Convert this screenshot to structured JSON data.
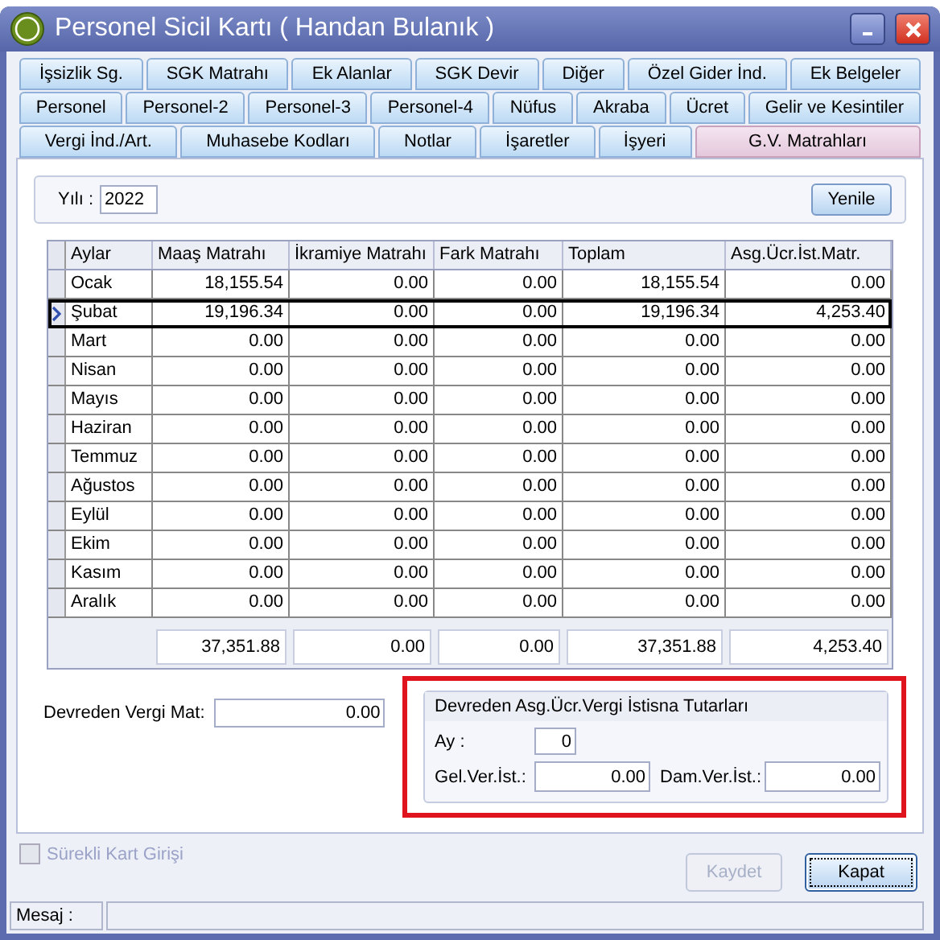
{
  "window": {
    "title": "Personel Sicil Kartı ( Handan Bulanık )"
  },
  "tab_rows": [
    [
      {
        "label": "İşsizlik Sg.",
        "selected": false
      },
      {
        "label": "SGK Matrahı",
        "selected": false
      },
      {
        "label": "Ek Alanlar",
        "selected": false
      },
      {
        "label": "SGK Devir",
        "selected": false
      },
      {
        "label": "Diğer",
        "selected": false
      },
      {
        "label": "Özel Gider İnd.",
        "selected": false
      },
      {
        "label": "Ek Belgeler",
        "selected": false
      }
    ],
    [
      {
        "label": "Personel",
        "selected": false
      },
      {
        "label": "Personel-2",
        "selected": false
      },
      {
        "label": "Personel-3",
        "selected": false
      },
      {
        "label": "Personel-4",
        "selected": false
      },
      {
        "label": "Nüfus",
        "selected": false
      },
      {
        "label": "Akraba",
        "selected": false
      },
      {
        "label": "Ücret",
        "selected": false
      },
      {
        "label": "Gelir ve Kesintiler",
        "selected": false
      }
    ],
    [
      {
        "label": "Vergi İnd./Art.",
        "selected": false
      },
      {
        "label": "Muhasebe Kodları",
        "selected": false
      },
      {
        "label": "Notlar",
        "selected": false
      },
      {
        "label": "İşaretler",
        "selected": false
      },
      {
        "label": "İşyeri",
        "selected": false
      },
      {
        "label": "G.V. Matrahları",
        "selected": true
      }
    ]
  ],
  "year": {
    "label": "Yılı :",
    "value": "2022"
  },
  "refresh_button": {
    "label": "Yenile"
  },
  "table": {
    "columns": [
      "Aylar",
      "Maaş Matrahı",
      "İkramiye Matrahı",
      "Fark Matrahı",
      "Toplam",
      "Asg.Ücr.İst.Matr."
    ],
    "rows": [
      {
        "cells": [
          "Ocak",
          "18,155.54",
          "0.00",
          "0.00",
          "18,155.54",
          "0.00"
        ],
        "selected": false
      },
      {
        "cells": [
          "Şubat",
          "19,196.34",
          "0.00",
          "0.00",
          "19,196.34",
          "4,253.40"
        ],
        "selected": true
      },
      {
        "cells": [
          "Mart",
          "0.00",
          "0.00",
          "0.00",
          "0.00",
          "0.00"
        ],
        "selected": false
      },
      {
        "cells": [
          "Nisan",
          "0.00",
          "0.00",
          "0.00",
          "0.00",
          "0.00"
        ],
        "selected": false
      },
      {
        "cells": [
          "Mayıs",
          "0.00",
          "0.00",
          "0.00",
          "0.00",
          "0.00"
        ],
        "selected": false
      },
      {
        "cells": [
          "Haziran",
          "0.00",
          "0.00",
          "0.00",
          "0.00",
          "0.00"
        ],
        "selected": false
      },
      {
        "cells": [
          "Temmuz",
          "0.00",
          "0.00",
          "0.00",
          "0.00",
          "0.00"
        ],
        "selected": false
      },
      {
        "cells": [
          "Ağustos",
          "0.00",
          "0.00",
          "0.00",
          "0.00",
          "0.00"
        ],
        "selected": false
      },
      {
        "cells": [
          "Eylül",
          "0.00",
          "0.00",
          "0.00",
          "0.00",
          "0.00"
        ],
        "selected": false
      },
      {
        "cells": [
          "Ekim",
          "0.00",
          "0.00",
          "0.00",
          "0.00",
          "0.00"
        ],
        "selected": false
      },
      {
        "cells": [
          "Kasım",
          "0.00",
          "0.00",
          "0.00",
          "0.00",
          "0.00"
        ],
        "selected": false
      },
      {
        "cells": [
          "Aralık",
          "0.00",
          "0.00",
          "0.00",
          "0.00",
          "0.00"
        ],
        "selected": false
      }
    ],
    "totals": [
      "37,351.88",
      "0.00",
      "0.00",
      "37,351.88",
      "4,253.40"
    ]
  },
  "carried_tax_base": {
    "label": "Devreden Vergi Mat:",
    "value": "0.00"
  },
  "exemption_group": {
    "title": "Devreden Asg.Ücr.Vergi İstisna Tutarları",
    "month": {
      "label": "Ay :",
      "value": "0"
    },
    "income_tax": {
      "label": "Gel.Ver.İst.:",
      "value": "0.00"
    },
    "stamp_tax": {
      "label": "Dam.Ver.İst.:",
      "value": "0.00"
    }
  },
  "continuous_entry": {
    "label": "Sürekli Kart Girişi",
    "checked": false,
    "disabled": true
  },
  "buttons": [
    {
      "label": "Kaydet",
      "disabled": true,
      "focused": false
    },
    {
      "label": "Kapat",
      "disabled": false,
      "focused": true
    }
  ],
  "status_bar": {
    "label": "Mesaj :"
  }
}
